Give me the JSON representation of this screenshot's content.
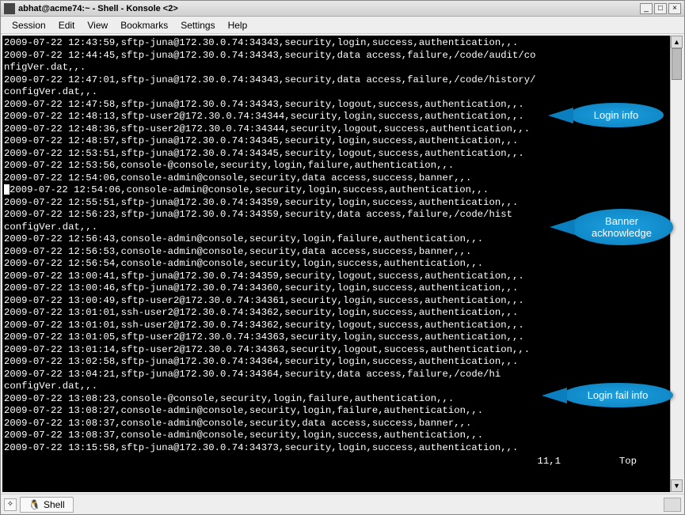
{
  "window": {
    "title": "abhat@acme74:~ - Shell - Konsole <2>",
    "min": "_",
    "max": "□",
    "close": "×"
  },
  "menu": [
    "Session",
    "Edit",
    "View",
    "Bookmarks",
    "Settings",
    "Help"
  ],
  "terminal_lines": [
    "2009-07-22 12:43:59,sftp-juna@172.30.0.74:34343,security,login,success,authentication,,.",
    "2009-07-22 12:44:45,sftp-juna@172.30.0.74:34343,security,data access,failure,/code/audit/co",
    "nfigVer.dat,,.",
    "2009-07-22 12:47:01,sftp-juna@172.30.0.74:34343,security,data access,failure,/code/history/",
    "configVer.dat,,.",
    "2009-07-22 12:47:58,sftp-juna@172.30.0.74:34343,security,logout,success,authentication,,.",
    "2009-07-22 12:48:13,sftp-user2@172.30.0.74:34344,security,login,success,authentication,,.",
    "2009-07-22 12:48:36,sftp-user2@172.30.0.74:34344,security,logout,success,authentication,,.",
    "2009-07-22 12:48:57,sftp-juna@172.30.0.74:34345,security,login,success,authentication,,.",
    "2009-07-22 12:53:51,sftp-juna@172.30.0.74:34345,security,logout,success,authentication,,.",
    "2009-07-22 12:53:56,console-@console,security,login,failure,authentication,,.",
    "2009-07-22 12:54:06,console-admin@console,security,data access,success,banner,,.",
    "2009-07-22 12:54:06,console-admin@console,security,login,success,authentication,,.",
    "2009-07-22 12:55:51,sftp-juna@172.30.0.74:34359,security,login,success,authentication,,.",
    "2009-07-22 12:56:23,sftp-juna@172.30.0.74:34359,security,data access,failure,/code/hist",
    "configVer.dat,,.",
    "2009-07-22 12:56:43,console-admin@console,security,login,failure,authentication,,.",
    "2009-07-22 12:56:53,console-admin@console,security,data access,success,banner,,.",
    "2009-07-22 12:56:54,console-admin@console,security,login,success,authentication,,.",
    "2009-07-22 13:00:41,sftp-juna@172.30.0.74:34359,security,logout,success,authentication,,.",
    "2009-07-22 13:00:46,sftp-juna@172.30.0.74:34360,security,login,success,authentication,,.",
    "2009-07-22 13:00:49,sftp-user2@172.30.0.74:34361,security,login,success,authentication,,.",
    "2009-07-22 13:01:01,ssh-user2@172.30.0.74:34362,security,login,success,authentication,,.",
    "2009-07-22 13:01:01,ssh-user2@172.30.0.74:34362,security,logout,success,authentication,,.",
    "2009-07-22 13:01:05,sftp-user2@172.30.0.74:34363,security,login,success,authentication,,.",
    "2009-07-22 13:01:14,sftp-user2@172.30.0.74:34363,security,logout,success,authentication,,.",
    "2009-07-22 13:02:58,sftp-juna@172.30.0.74:34364,security,login,success,authentication,,.",
    "2009-07-22 13:04:21,sftp-juna@172.30.0.74:34364,security,data access,failure,/code/hi",
    "configVer.dat,,.",
    "2009-07-22 13:08:23,console-@console,security,login,failure,authentication,,.",
    "2009-07-22 13:08:27,console-admin@console,security,login,failure,authentication,,.",
    "2009-07-22 13:08:37,console-admin@console,security,data access,success,banner,,.",
    "2009-07-22 13:08:37,console-admin@console,security,login,success,authentication,,.",
    "2009-07-22 13:15:58,sftp-juna@172.30.0.74:34373,security,login,success,authentication,,."
  ],
  "status_line": "11,1          Top",
  "tab": {
    "label": "Shell",
    "icon": "🐧"
  },
  "callouts": {
    "c1": "Login info",
    "c2": "Banner\nacknowledge",
    "c3": "Login fail info"
  }
}
